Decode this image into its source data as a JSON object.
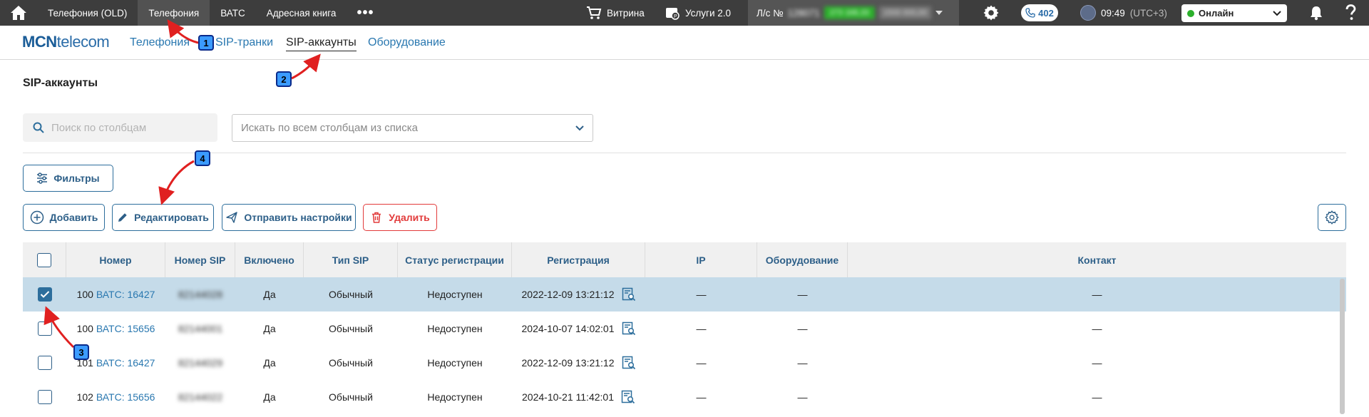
{
  "topbar": {
    "tabs": [
      {
        "label": "Телефония (OLD)"
      },
      {
        "label": "Телефония"
      },
      {
        "label": "ВАТС"
      },
      {
        "label": "Адресная книга"
      }
    ],
    "more": "•••",
    "vitrina": "Витрина",
    "services": "Услуги 2.0",
    "account_label": "Л/с №",
    "account_number": "128071",
    "account_balance": "273 168,33",
    "account_extra": "1500 000,00",
    "calls_count": "402",
    "time": "09:49",
    "timezone": "(UTC+3)",
    "status": "Онлайн"
  },
  "subnav": {
    "logo_bold": "MCN",
    "logo_rest": "telecom",
    "tabs": [
      {
        "label": "Телефония"
      },
      {
        "label": "SIP-транки"
      },
      {
        "label": "SIP-аккаунты"
      },
      {
        "label": "Оборудование"
      }
    ]
  },
  "page": {
    "title": "SIP-аккаунты",
    "search_placeholder": "Поиск по столбцам",
    "select_placeholder": "Искать по всем столбцам из списка"
  },
  "buttons": {
    "filters": "Фильтры",
    "add": "Добавить",
    "edit": "Редактировать",
    "send": "Отправить настройки",
    "delete": "Удалить"
  },
  "table": {
    "headers": [
      "Номер",
      "Номер SIP",
      "Включено",
      "Тип SIP",
      "Статус регистрации",
      "Регистрация",
      "IP",
      "Оборудование",
      "Контакт"
    ],
    "rows": [
      {
        "num": "100",
        "vats": "ВАТС: 16427",
        "sip": "82144028",
        "enabled": "Да",
        "type": "Обычный",
        "status": "Недоступен",
        "reg": "2022-12-09 13:21:12",
        "ip": "—",
        "equip": "—",
        "contact": "—",
        "checked": true
      },
      {
        "num": "100",
        "vats": "ВАТС: 15656",
        "sip": "82144001",
        "enabled": "Да",
        "type": "Обычный",
        "status": "Недоступен",
        "reg": "2024-10-07 14:02:01",
        "ip": "—",
        "equip": "—",
        "contact": "—",
        "checked": false
      },
      {
        "num": "101",
        "vats": "ВАТС: 16427",
        "sip": "82144029",
        "enabled": "Да",
        "type": "Обычный",
        "status": "Недоступен",
        "reg": "2022-12-09 13:21:12",
        "ip": "—",
        "equip": "—",
        "contact": "—",
        "checked": false
      },
      {
        "num": "102",
        "vats": "ВАТС: 15656",
        "sip": "82144022",
        "enabled": "Да",
        "type": "Обычный",
        "status": "Недоступен",
        "reg": "2024-10-21 11:42:01",
        "ip": "—",
        "equip": "—",
        "contact": "—",
        "checked": false
      }
    ]
  },
  "annotations": [
    "1",
    "2",
    "3",
    "4"
  ],
  "colors": {
    "accent": "#2d6e9c",
    "danger": "#e23b3b",
    "selected_row": "#c5dbe9",
    "topbar": "#3d3d3d",
    "arrow": "#e02020"
  }
}
